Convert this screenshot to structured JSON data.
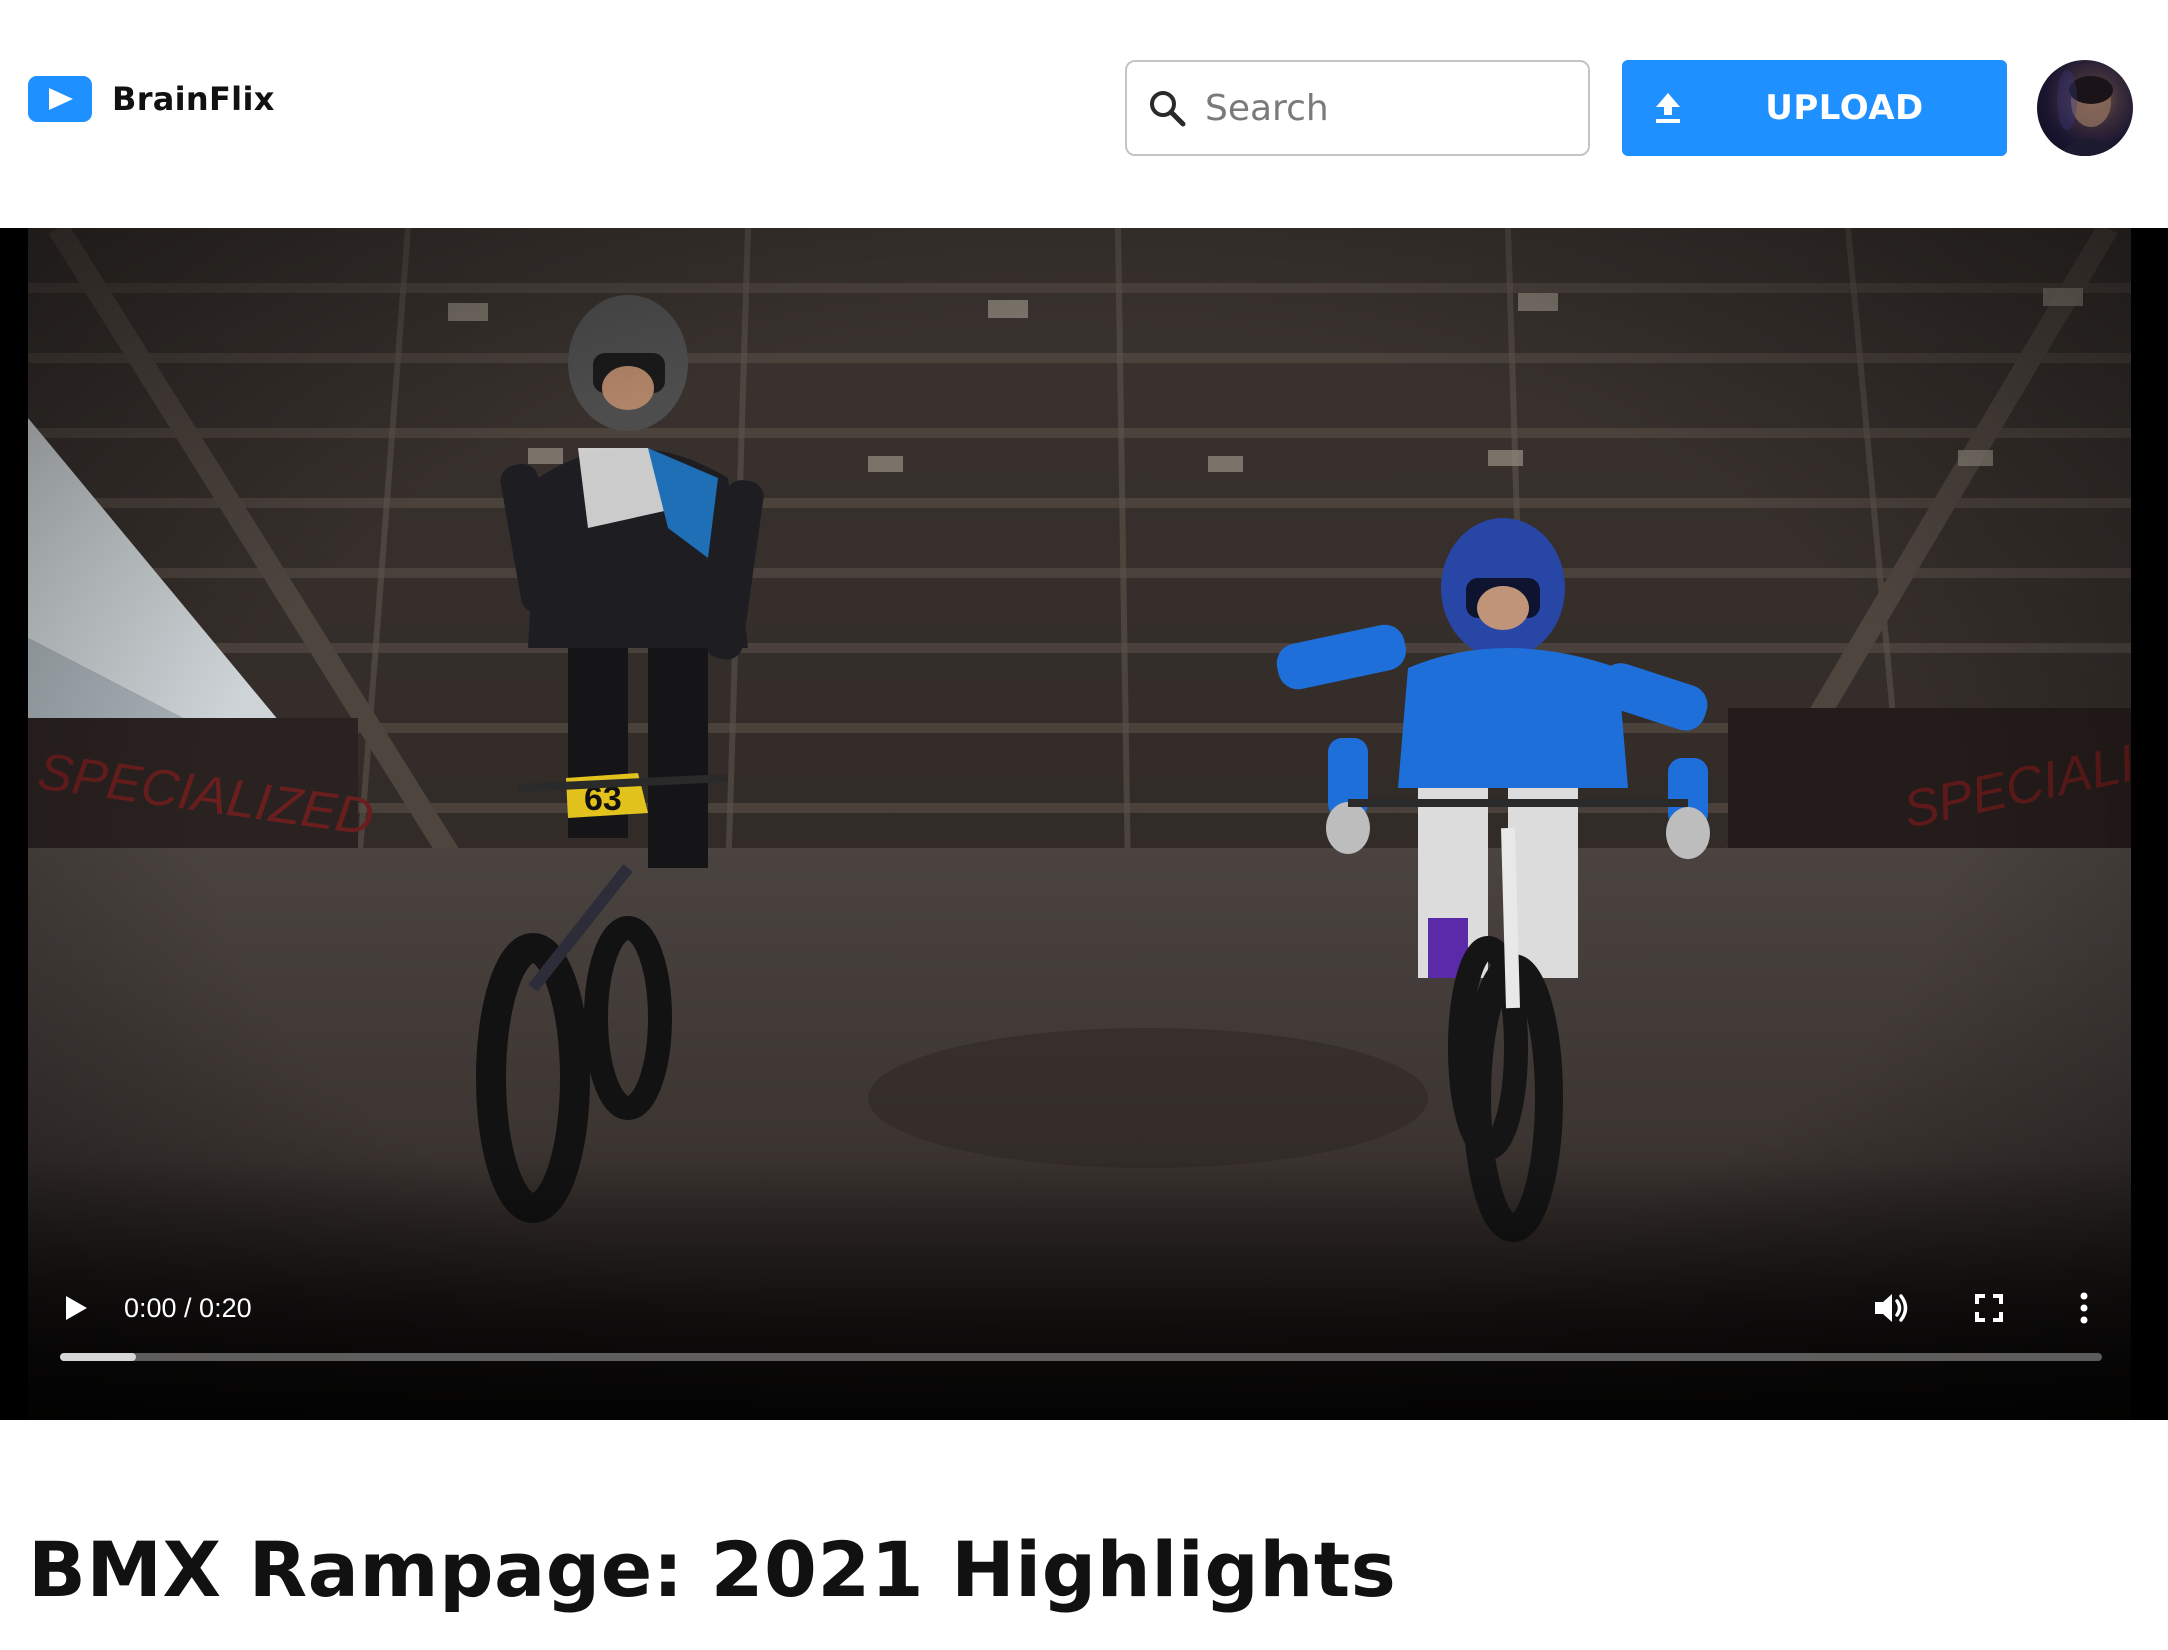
{
  "app": {
    "name": "BrainFlix"
  },
  "header": {
    "logo_icon": "play-icon",
    "search": {
      "placeholder": "Search",
      "value": "",
      "icon": "search-icon"
    },
    "upload": {
      "label": "UPLOAD",
      "icon": "upload-icon"
    },
    "avatar": {
      "icon": "user-avatar"
    }
  },
  "video": {
    "current_time": "0:00",
    "duration": "0:20",
    "time_display": "0:00 / 0:20",
    "progress_fraction": 0,
    "buffered_fraction": 0.037,
    "controls": {
      "play": "play-icon",
      "volume": "volume-icon",
      "fullscreen": "fullscreen-icon",
      "more": "more-vertical-icon"
    }
  },
  "main": {
    "title": "BMX Rampage: 2021 Highlights"
  },
  "colors": {
    "brand": "#1e90ff",
    "text": "#111111",
    "player_bg": "#000000"
  }
}
